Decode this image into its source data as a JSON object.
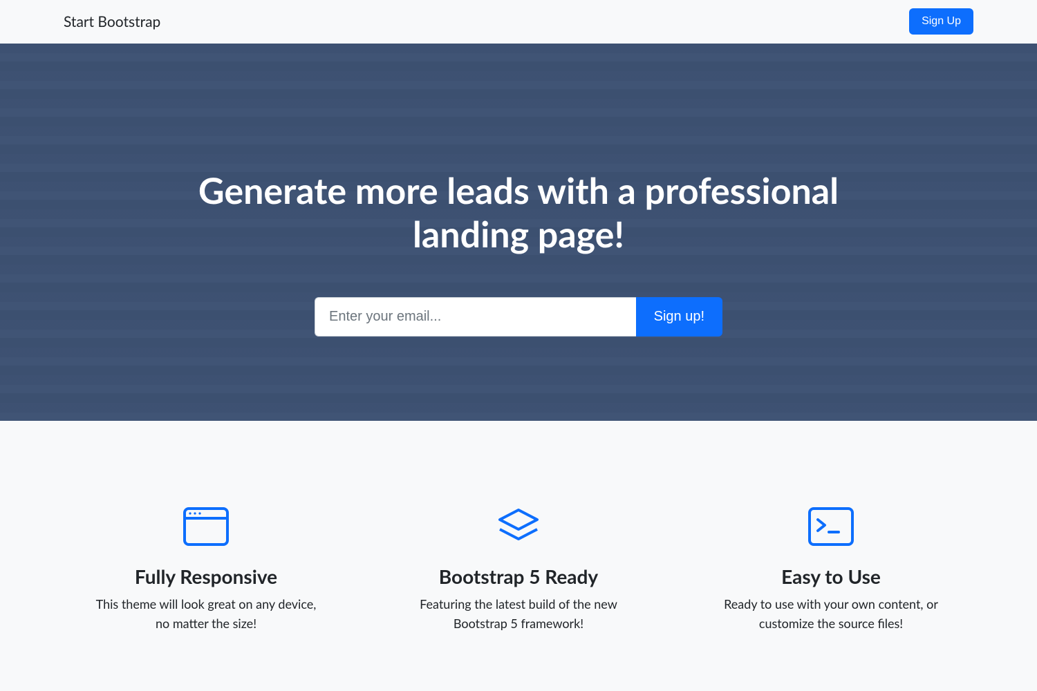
{
  "nav": {
    "brand": "Start Bootstrap",
    "signup_label": "Sign Up"
  },
  "hero": {
    "headline": "Generate more leads with a professional landing page!",
    "email_placeholder": "Enter your email...",
    "submit_label": "Sign up!"
  },
  "features": [
    {
      "title": "Fully Responsive",
      "desc": "This theme will look great on any device, no matter the size!",
      "icon": "window-icon"
    },
    {
      "title": "Bootstrap 5 Ready",
      "desc": "Featuring the latest build of the new Bootstrap 5 framework!",
      "icon": "layers-icon"
    },
    {
      "title": "Easy to Use",
      "desc": "Ready to use with your own content, or customize the source files!",
      "icon": "terminal-icon"
    }
  ],
  "colors": {
    "primary": "#0d6efd",
    "body_bg": "#f8f9fa",
    "hero_overlay": "#3f5271"
  }
}
